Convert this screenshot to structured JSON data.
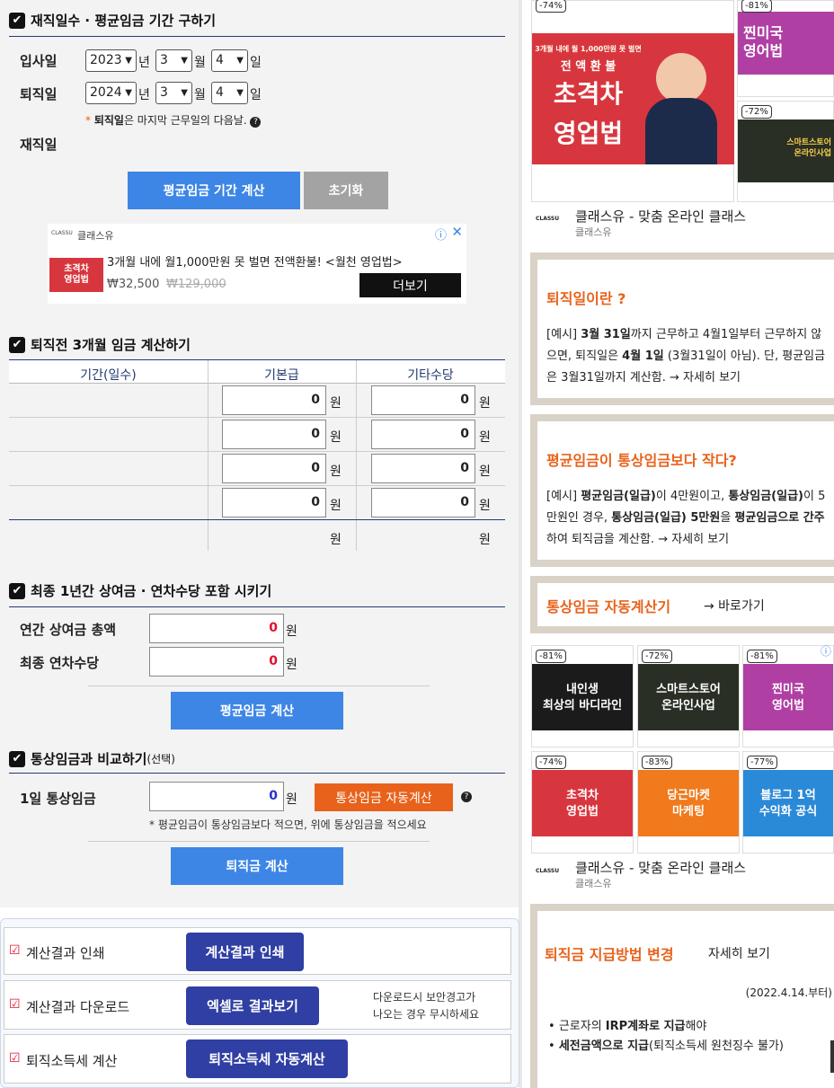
{
  "section1": {
    "title": "재직일수 · 평균임금 기간 구하기",
    "join_label": "입사일",
    "leave_label": "퇴직일",
    "join": {
      "year": "2023",
      "month": "3",
      "day": "4"
    },
    "leave": {
      "year": "2024",
      "month": "3",
      "day": "4"
    },
    "year_unit": "년",
    "month_unit": "월",
    "day_unit": "일",
    "note_star": "*",
    "note_bold": "퇴직일",
    "note_rest": "은 마지막 근무일의 다음날.",
    "tenure_label": "재직일",
    "calc_button": "평균임금 기간 계산",
    "reset_button": "초기화"
  },
  "ad_banner": {
    "brand": "클래스유",
    "text": "3개월 내에 월1,000만원 못 벌면 전액환불! <월천 영업법>",
    "price": "₩32,500",
    "old_price": "₩129,000",
    "button": "더보기",
    "thumb_text": "초격차\n영업법",
    "logo": "CLASSU"
  },
  "section2": {
    "title": "퇴직전 3개월 임금 계산하기",
    "headers": [
      "기간(일수)",
      "기본급",
      "기타수당"
    ],
    "rows": [
      {
        "basic": "0",
        "extra": "0"
      },
      {
        "basic": "0",
        "extra": "0"
      },
      {
        "basic": "0",
        "extra": "0"
      },
      {
        "basic": "0",
        "extra": "0"
      }
    ],
    "won": "원",
    "total_basic": "원",
    "total_extra": "원"
  },
  "section3": {
    "title": "최종 1년간 상여금 · 연차수당 포함 시키기",
    "bonus_label": "연간 상여금 총액",
    "bonus_value": "0",
    "annual_label": "최종 연차수당",
    "annual_value": "0",
    "won": "원",
    "calc_button": "평균임금 계산"
  },
  "section4": {
    "title": "통상임금과 비교하기",
    "title_small": "(선택)",
    "daily_label": "1일 통상임금",
    "daily_value": "0",
    "won": "원",
    "auto_button": "통상임금 자동계산",
    "note": "* 평균임금이 통상임금보다 적으면, 위에 통상임금을 적으세요",
    "calc_button": "퇴직금 계산"
  },
  "results": [
    {
      "label": "계산결과 인쇄",
      "button": "계산결과 인쇄",
      "note1": "",
      "note2": ""
    },
    {
      "label": "계산결과 다운로드",
      "button": "엑셀로 결과보기",
      "note1": "다운로드시 보안경고가",
      "note2": "나오는 경우 무시하세요"
    },
    {
      "label": "퇴직소득세 계산",
      "button": "퇴직소득세 자동계산",
      "note1": "",
      "note2": ""
    }
  ],
  "right": {
    "ad1": {
      "discount_main": "-74%",
      "main_top": "3개월 내에 월 1,000만원 못 벌면",
      "main_sub": "전 액 환 불",
      "main_title1": "초격차",
      "main_title2": "영업법",
      "d2": "-81%",
      "small1": "찐미국\n영어법",
      "d3": "-72%",
      "small2": "스마트스토어\n온라인사업",
      "brand_line": "클래스유 - 맞춤 온라인 클래스",
      "brand_sub": "클래스유",
      "logo": "CLASSU"
    },
    "box1": {
      "title": "퇴직일이란 ?",
      "p1": "[예시] ",
      "p1b": "3월 31일",
      "p1c": "까지 근무하고 4월1일부터 근무하지 않으면, 퇴직일은 ",
      "p1d": "4월 1일",
      "p1e": " (3월31일이 아님). 단, 평균임금은 3월31일까지 계산함.",
      "link": "→ 자세히 보기"
    },
    "box2": {
      "title": "평균임금이 통상임금보다 작다?",
      "a": "[예시] ",
      "b": "평균임금(일급)",
      "c": "이 4만원이고, ",
      "d": "통상임금(일급)",
      "e": "이 5만원인 경우, ",
      "f": "통상임금(일급) 5만원",
      "g": "을 ",
      "h": "평균임금으로 간주",
      "i": "하여 퇴직금을 계산함.",
      "link": "→ 자세히 보기"
    },
    "box3": {
      "title": "통상임금 자동계산기",
      "link": "→ 바로가기"
    },
    "ad2": {
      "items": [
        {
          "d": "-81%",
          "t": "내인생\n최상의 바디라인",
          "bg": "#1b1b1b"
        },
        {
          "d": "-72%",
          "t": "스마트스토어\n온라인사업",
          "bg": "#2a2f25"
        },
        {
          "d": "-81%",
          "t": "찐미국\n영어법",
          "bg": "#b03fa3"
        },
        {
          "d": "-74%",
          "t": "초격차\n영업법",
          "bg": "#d8363e"
        },
        {
          "d": "-83%",
          "t": "당근마켓\n마케팅",
          "bg": "#f07a1c"
        },
        {
          "d": "-77%",
          "t": "블로그 1억\n수익화 공식",
          "bg": "#2a8ad8"
        }
      ],
      "brand_line": "클래스유 - 맞춤 온라인 클래스",
      "brand_sub": "클래스유",
      "logo": "CLASSU"
    },
    "box4": {
      "title": "퇴직금 지급방법 변경",
      "link": "자세히 보기",
      "date": "(2022.4.14.부터)",
      "li1a": "근로자의 ",
      "li1b": "IRP계좌로 지급",
      "li1c": "해야",
      "li2a": "세전금액으로 지급",
      "li2b": "(퇴직소득세 원천징수 불가)"
    }
  },
  "colors": {
    "blue_btn": "#3d86e6",
    "gray_btn": "#a3a3a3",
    "orange": "#e8621b",
    "navy_btn": "#2f3fa3",
    "red": "#e0102d"
  }
}
